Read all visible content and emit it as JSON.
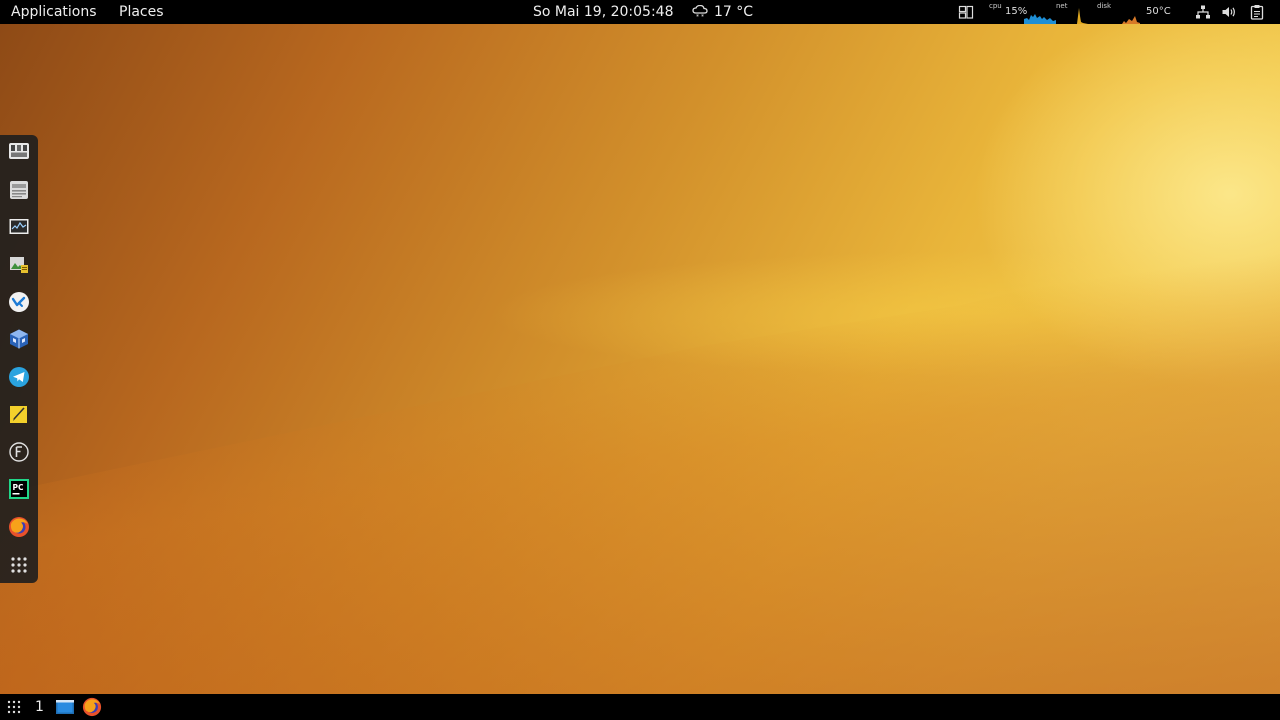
{
  "top_panel": {
    "applications_label": "Applications",
    "places_label": "Places",
    "clock_text": "So Mai 19, 20:05:48",
    "weather": {
      "icon": "cloud-snow-icon",
      "temperature": "17 °C"
    },
    "tray": {
      "cpu_label": "cpu",
      "cpu_value": "15%",
      "net_label": "net",
      "disk_label": "disk",
      "temp_value": "50°C",
      "icons": [
        "window-tiling-icon",
        "network-icon",
        "volume-icon",
        "clipboard-icon"
      ]
    }
  },
  "dock": {
    "items": [
      {
        "name": "dashboard-icon"
      },
      {
        "name": "files-icon"
      },
      {
        "name": "system-monitor-icon"
      },
      {
        "name": "image-viewer-icon"
      },
      {
        "name": "vscode-icon"
      },
      {
        "name": "virtualbox-icon"
      },
      {
        "name": "telegram-icon"
      },
      {
        "name": "notes-icon"
      },
      {
        "name": "font-manager-icon"
      },
      {
        "name": "pycharm-icon"
      },
      {
        "name": "firefox-icon"
      },
      {
        "name": "app-grid-icon"
      }
    ]
  },
  "bottom_panel": {
    "workspace_number": "1",
    "tasks": [
      "terminal-icon",
      "firefox-icon"
    ]
  },
  "colors": {
    "panel_bg": "#000000",
    "dock_bg": "#1e1e1e",
    "wallpaper_dark": "#8e4a16",
    "wallpaper_light": "#f6d35a"
  }
}
